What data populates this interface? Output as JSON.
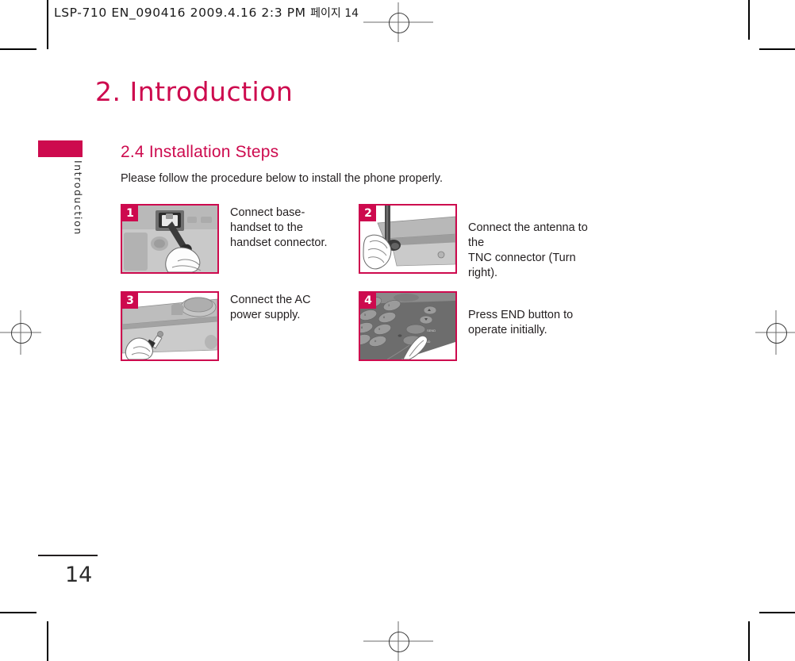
{
  "prepress": {
    "slug_main": "LSP-710 EN_090416  2009.4.16 2:3 PM",
    "slug_korean": "페이지 14"
  },
  "chapter": {
    "title": "2. Introduction"
  },
  "sidebar": {
    "tab_label": "Introduction"
  },
  "section": {
    "heading": "2.4  Installation Steps",
    "intro": "Please follow the procedure below to install the phone properly."
  },
  "steps": [
    {
      "number": "1",
      "caption": "Connect base-\nhandset to the\nhandset connector.",
      "figure_name": "handset-connector-photo"
    },
    {
      "number": "2",
      "caption": "Connect the antenna to the\nTNC connector (Turn right).",
      "figure_name": "antenna-tnc-photo"
    },
    {
      "number": "3",
      "caption": "Connect the AC\npower supply.",
      "figure_name": "ac-power-supply-photo"
    },
    {
      "number": "4",
      "caption": "Press END button to\noperate initially.",
      "figure_name": "end-button-keypad-photo"
    }
  ],
  "footer": {
    "page_number": "14"
  },
  "colors": {
    "brand_crimson": "#cd0a4e",
    "body_text": "#231f20"
  }
}
